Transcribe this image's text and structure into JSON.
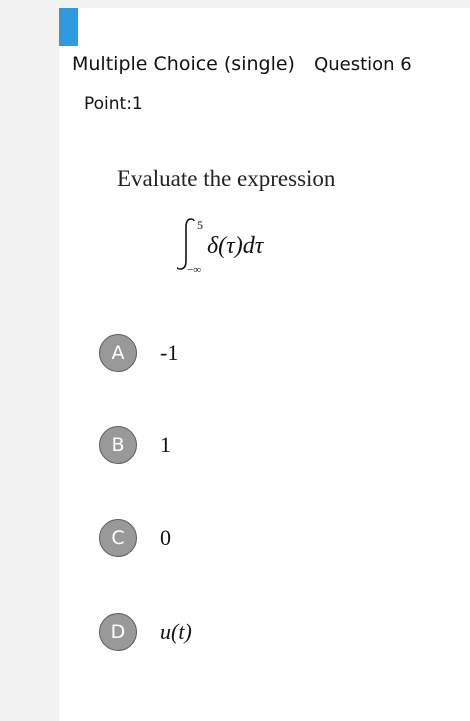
{
  "question": {
    "type": "Multiple Choice (single)",
    "number": "Question 6",
    "points": "Point:1",
    "stem": "Evaluate the expression",
    "formula": {
      "upper_limit": "5",
      "lower_limit": "−∞",
      "integrand": "δ(τ)dτ"
    }
  },
  "options": [
    {
      "letter": "A",
      "text": "-1"
    },
    {
      "letter": "B",
      "text": "1"
    },
    {
      "letter": "C",
      "text": "0"
    },
    {
      "letter": "D",
      "text": "u(t)"
    }
  ],
  "colors": {
    "accent": "#2f9ae0",
    "option_circle": "#999999"
  }
}
